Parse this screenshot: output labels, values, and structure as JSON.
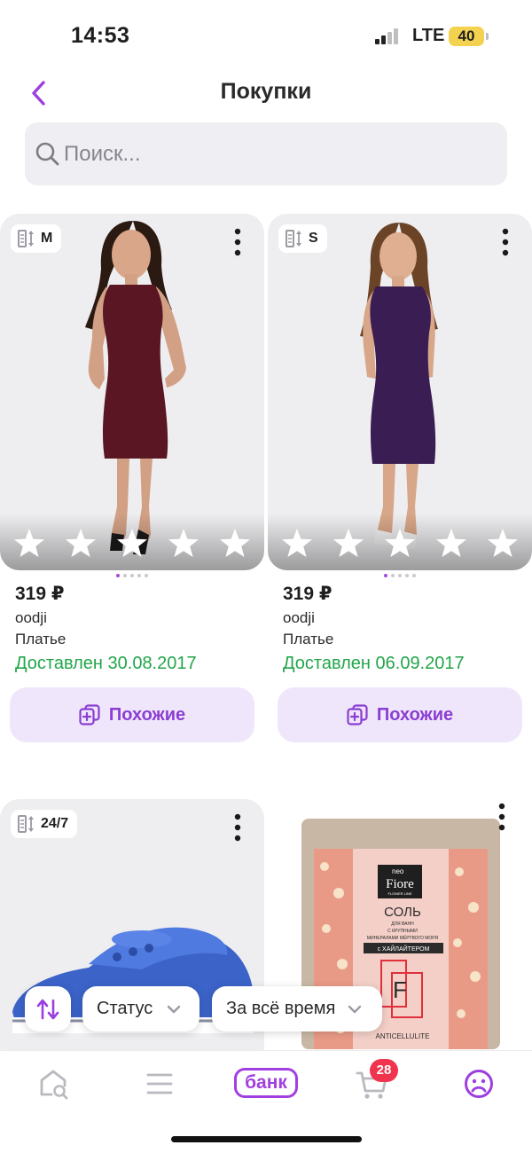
{
  "status_bar": {
    "time": "14:53",
    "network": "LTE",
    "battery": "40"
  },
  "header": {
    "title": "Покупки"
  },
  "search": {
    "placeholder": "Поиск..."
  },
  "colors": {
    "accent": "#a23fe0",
    "delivered": "#22a64a",
    "similar_bg": "#f0e6fb",
    "badge": "#f0344d",
    "dress_1": "#5a1622",
    "dress_2": "#3a1d52"
  },
  "products": [
    {
      "size": "M",
      "price": "319 ₽",
      "brand": "oodji",
      "category": "Платье",
      "status": "Доставлен 30.08.2017",
      "similar_label": "Похожие",
      "rating_stars": 5
    },
    {
      "size": "S",
      "price": "319 ₽",
      "brand": "oodji",
      "category": "Платье",
      "status": "Доставлен 06.09.2017",
      "similar_label": "Похожие",
      "rating_stars": 5
    },
    {
      "size": "24/7"
    },
    {
      "package": {
        "brand_top": "neo",
        "brand": "Fiore",
        "brand_sub": "FLOWER LINE",
        "title": "СОЛЬ",
        "line1": "ДЛЯ ВАНН",
        "line2": "С КРУПНЫМИ",
        "line3": "МИНЕРАЛАМИ МЁРТВОГО МОРЯ",
        "band": "с ХАЙЛАЙТЕРОМ",
        "logo": "F",
        "footer": "ANTICELLULITE"
      }
    }
  ],
  "filters": {
    "status_label": "Статус",
    "period_label": "За всё время"
  },
  "tab_bar": {
    "bank_label": "банк",
    "cart_count": "28"
  },
  "icons": [
    "back-chevron-icon",
    "search-icon",
    "size-icon",
    "more-vertical-icon",
    "star-icon",
    "similar-icon",
    "sort-icon",
    "chevron-down-icon",
    "home-search-icon",
    "catalog-menu-icon",
    "cart-icon",
    "profile-icon"
  ]
}
